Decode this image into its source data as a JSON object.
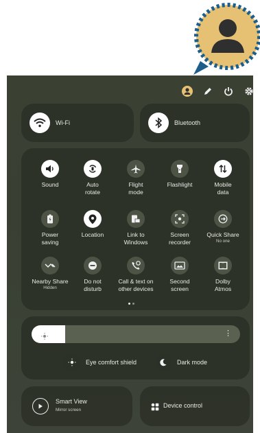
{
  "callout": {
    "icon": "person-icon",
    "colors": {
      "ring": "#1d5f8a",
      "fill": "#e6c173",
      "figure": "#2f2f2f"
    }
  },
  "top_icons": [
    "account-icon",
    "edit-icon",
    "power-icon",
    "settings-icon"
  ],
  "wifi": {
    "label": "Wi-Fi"
  },
  "bluetooth": {
    "label": "Bluetooth"
  },
  "tiles": [
    {
      "title": "Sound",
      "sub": "",
      "icon": "sound-icon",
      "on": true
    },
    {
      "title": "Auto\nrotate",
      "sub": "",
      "icon": "auto-rotate-icon",
      "on": true
    },
    {
      "title": "Flight\nmode",
      "sub": "",
      "icon": "airplane-icon",
      "on": false
    },
    {
      "title": "Flashlight",
      "sub": "",
      "icon": "flashlight-icon",
      "on": false
    },
    {
      "title": "Mobile\ndata",
      "sub": "",
      "icon": "mobile-data-icon",
      "on": true
    },
    {
      "title": "Power\nsaving",
      "sub": "",
      "icon": "battery-icon",
      "on": false
    },
    {
      "title": "Location",
      "sub": "",
      "icon": "location-icon",
      "on": true
    },
    {
      "title": "Link to\nWindows",
      "sub": "",
      "icon": "link-windows-icon",
      "on": false
    },
    {
      "title": "Screen\nrecorder",
      "sub": "",
      "icon": "screen-recorder-icon",
      "on": false
    },
    {
      "title": "Quick Share",
      "sub": "No one",
      "icon": "quick-share-icon",
      "on": false
    },
    {
      "title": "Nearby Share",
      "sub": "Hidden",
      "icon": "nearby-share-icon",
      "on": false
    },
    {
      "title": "Do not\ndisturb",
      "sub": "",
      "icon": "do-not-disturb-icon",
      "on": false
    },
    {
      "title": "Call & text on\nother devices",
      "sub": "",
      "icon": "call-text-icon",
      "on": false
    },
    {
      "title": "Second\nscreen",
      "sub": "",
      "icon": "second-screen-icon",
      "on": false
    },
    {
      "title": "Dolby\nAtmos",
      "sub": "",
      "icon": "dolby-icon",
      "on": false
    }
  ],
  "brightness": {
    "level": 0.16,
    "icon": "sun-icon"
  },
  "eye_comfort": {
    "label": "Eye comfort shield"
  },
  "dark_mode": {
    "label": "Dark mode"
  },
  "smart_view": {
    "title": "Smart View",
    "sub": "Mirror screen"
  },
  "device_control": {
    "label": "Device control"
  },
  "colors": {
    "panel": "#3a4133",
    "card": "#2b3027",
    "accent": "#ffffff"
  }
}
